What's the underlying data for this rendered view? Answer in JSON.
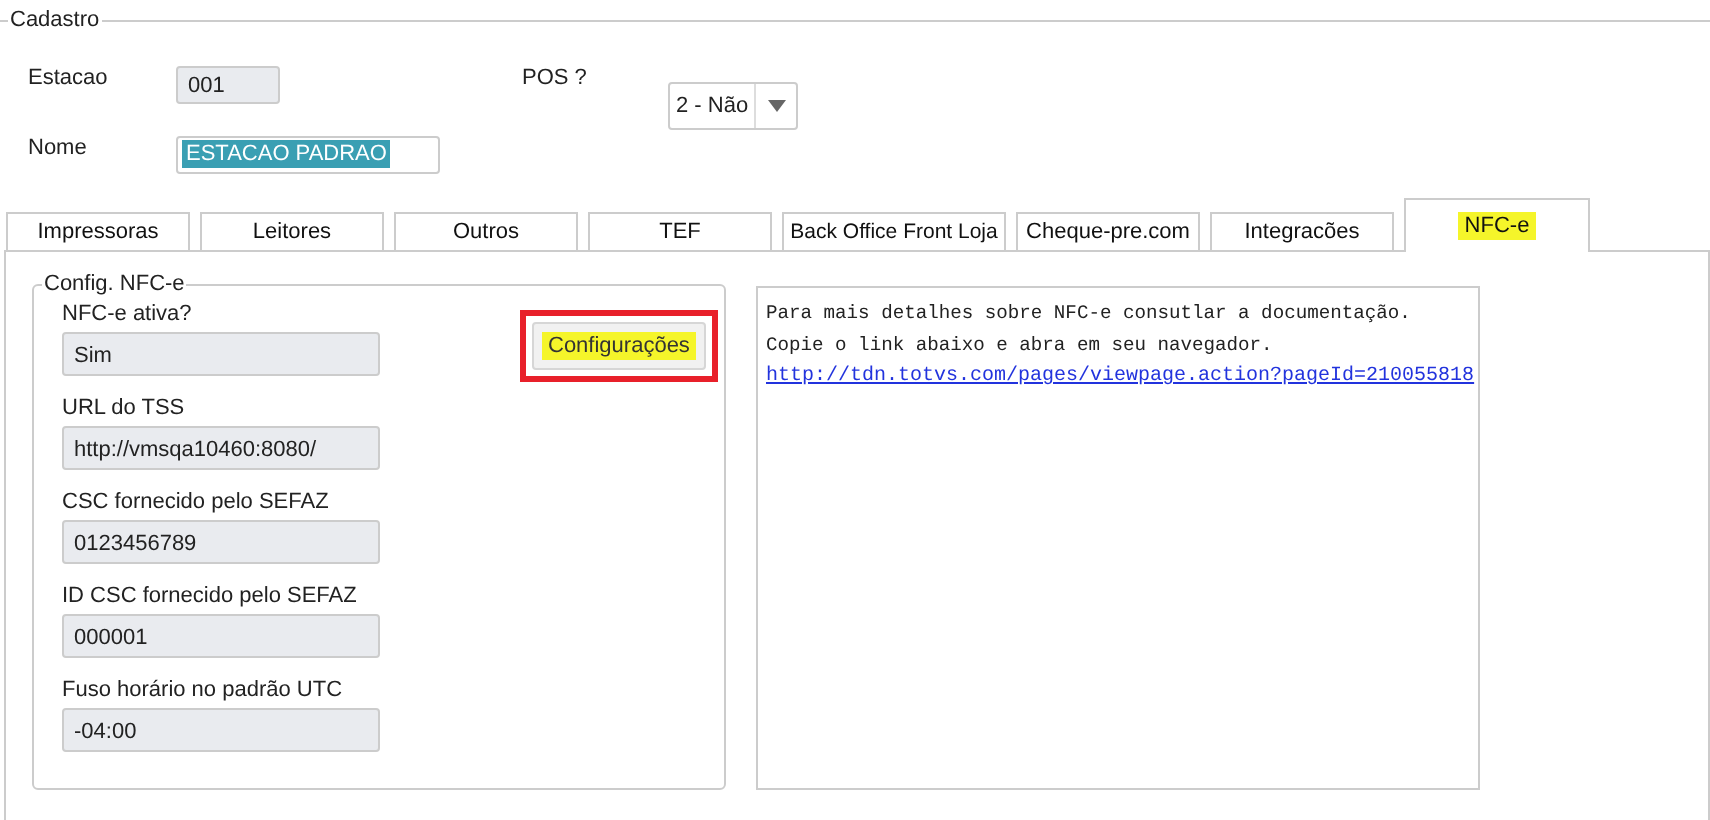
{
  "cadastro": {
    "title": "Cadastro",
    "estacao": {
      "label": "Estacao",
      "value": "001",
      "disabled": true
    },
    "pos": {
      "label": "POS ?",
      "value": "2 - Não"
    },
    "nome": {
      "label": "Nome",
      "value": "ESTACAO PADRAO",
      "selected": true
    }
  },
  "tabs": [
    {
      "label": "Impressoras",
      "selected": false,
      "highlighted": false
    },
    {
      "label": "Leitores",
      "selected": false,
      "highlighted": false
    },
    {
      "label": "Outros",
      "selected": false,
      "highlighted": false
    },
    {
      "label": "TEF",
      "selected": false,
      "highlighted": false
    },
    {
      "label": "Back Office Front Loja",
      "selected": false,
      "highlighted": false
    },
    {
      "label": "Cheque-pre.com",
      "selected": false,
      "highlighted": false
    },
    {
      "label": "Integracões",
      "selected": false,
      "highlighted": false
    },
    {
      "label": "NFC-e",
      "selected": true,
      "highlighted": true
    }
  ],
  "config": {
    "title": "Config. NFC-e",
    "fields": [
      {
        "label": "NFC-e ativa?",
        "value": "Sim"
      },
      {
        "label": "URL do TSS",
        "value": "http://vmsqa10460:8080/"
      },
      {
        "label": "CSC fornecido pelo SEFAZ",
        "value": "0123456789"
      },
      {
        "label": "ID CSC fornecido pelo SEFAZ",
        "value": "000001"
      },
      {
        "label": "Fuso horário no padrão UTC",
        "value": "-04:00"
      }
    ],
    "button": {
      "label": "Configurações",
      "highlighted": true,
      "boxed": true
    }
  },
  "info": {
    "text": "Para mais detalhes sobre NFC-e consutlar a documentação. Copie o link abaixo e abra em seu navegador.",
    "link": "http://tdn.totvs.com/pages/viewpage.action?pageId=210055818"
  }
}
